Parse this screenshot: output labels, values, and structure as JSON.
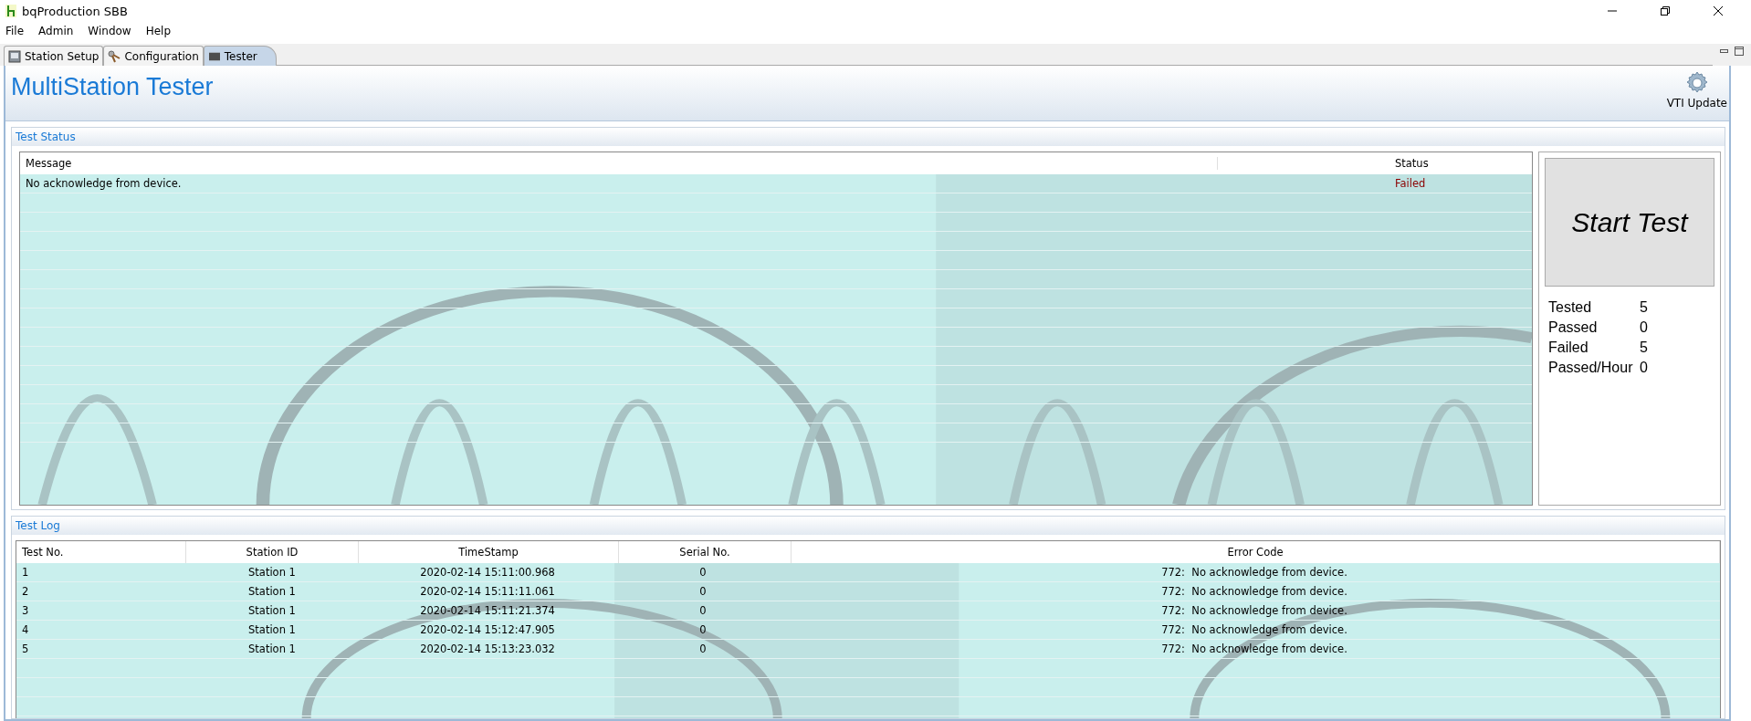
{
  "window": {
    "title": "bqProduction SBB"
  },
  "menu": [
    "File",
    "Admin",
    "Window",
    "Help"
  ],
  "tabs": [
    {
      "label": "Station Setup",
      "kind": "setup",
      "selected": false
    },
    {
      "label": "Configuration",
      "kind": "config",
      "selected": false
    },
    {
      "label": "Tester",
      "kind": "tester",
      "selected": true
    }
  ],
  "page_title": "MultiStation Tester",
  "toolbar": {
    "update_button": "VTI Update"
  },
  "test_status": {
    "title": "Test Status",
    "columns": [
      "Message",
      "Status"
    ],
    "rows": [
      {
        "message": "No acknowledge from device.",
        "status": "Failed"
      }
    ]
  },
  "start_button": "Start Test",
  "counters": [
    {
      "label": "Tested",
      "value": "5"
    },
    {
      "label": "Passed",
      "value": "0"
    },
    {
      "label": "Failed",
      "value": "5"
    },
    {
      "label": "Passed/Hour",
      "value": "0"
    }
  ],
  "test_log": {
    "title": "Test Log",
    "columns": [
      "Test No.",
      "Station ID",
      "TimeStamp",
      "Serial No.",
      "Error Code"
    ],
    "rows": [
      [
        "1",
        "Station 1",
        "2020-02-14 15:11:00.968",
        "0",
        "772:  No acknowledge from device."
      ],
      [
        "2",
        "Station 1",
        "2020-02-14 15:11:11.061",
        "0",
        "772:  No acknowledge from device."
      ],
      [
        "3",
        "Station 1",
        "2020-02-14 15:11:21.374",
        "0",
        "772:  No acknowledge from device."
      ],
      [
        "4",
        "Station 1",
        "2020-02-14 15:12:47.905",
        "0",
        "772:  No acknowledge from device."
      ],
      [
        "5",
        "Station 1",
        "2020-02-14 15:13:23.032",
        "0",
        "772:  No acknowledge from device."
      ]
    ]
  }
}
